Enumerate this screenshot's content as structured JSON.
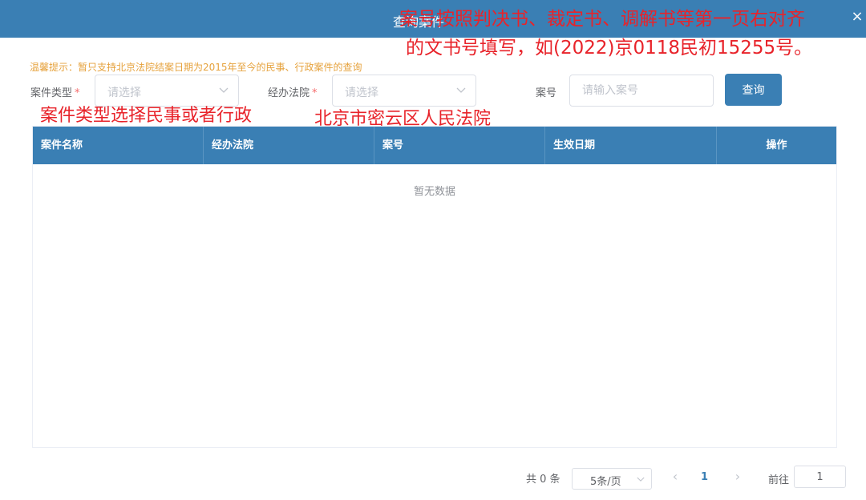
{
  "header": {
    "title": "查询案件",
    "close_icon": "×"
  },
  "annotations": {
    "top_line1": "案号按照判决书、裁定书、调解书等第一页右对齐",
    "top_line2": "的文书号填写，如(2022)京0118民初15255号。",
    "case_type_hint": "案件类型选择民事或者行政",
    "court_hint": "北京市密云区人民法院",
    "color": "#e8232a"
  },
  "notice": "温馨提示：暂只支持北京法院结案日期为2015年至今的民事、行政案件的查询",
  "form": {
    "case_type": {
      "label": "案件类型",
      "required_mark": "*",
      "placeholder": "请选择"
    },
    "court": {
      "label": "经办法院",
      "required_mark": "*",
      "placeholder": "请选择"
    },
    "case_number": {
      "label": "案号",
      "placeholder": "请输入案号"
    },
    "query_button": "查询"
  },
  "table": {
    "columns": [
      "案件名称",
      "经办法院",
      "案号",
      "生效日期",
      "操作"
    ],
    "empty_text": "暂无数据"
  },
  "pagination": {
    "total": "共 0 条",
    "page_size": "5条/页",
    "prev_icon": "‹",
    "current_page": "1",
    "next_icon": "›",
    "goto_label": "前往",
    "goto_value": "1"
  },
  "colors": {
    "primary": "#3a7fb4",
    "notice": "#e6a23c",
    "required": "#f56c6c"
  }
}
